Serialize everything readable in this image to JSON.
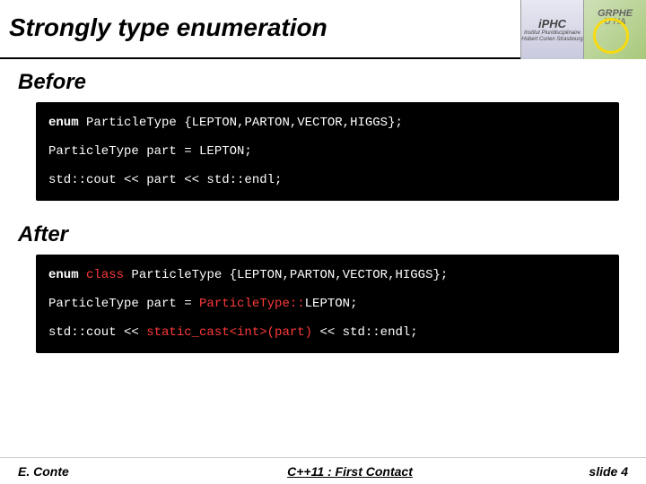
{
  "title": "Strongly type enumeration",
  "logos": {
    "iphc": {
      "name": "iPHC",
      "sub": "Institut Pluridisciplinaire\nHubert Curien\nStrasbourg"
    },
    "grphe": {
      "name": "GRPHE",
      "sub": "U HA"
    }
  },
  "sections": {
    "before": {
      "label": "Before",
      "code": {
        "l1a": "enum ",
        "l1b": "ParticleType {LEPTON,PARTON,VECTOR,HIGGS};",
        "l2": "ParticleType  part = LEPTON;",
        "l3": "std::cout << part << std::endl;"
      }
    },
    "after": {
      "label": "After",
      "code": {
        "l1a": "enum ",
        "l1b": "class",
        "l1c": " ParticleType {LEPTON,PARTON,VECTOR,HIGGS};",
        "l2a": "ParticleType  part = ",
        "l2b": "ParticleType::",
        "l2c": "LEPTON;",
        "l3a": "std::cout << ",
        "l3b": "static_cast<int>(part)",
        "l3c": " << std::endl;"
      }
    }
  },
  "footer": {
    "author": "E. Conte",
    "title": "C++11 : First Contact",
    "slide": "slide 4"
  }
}
